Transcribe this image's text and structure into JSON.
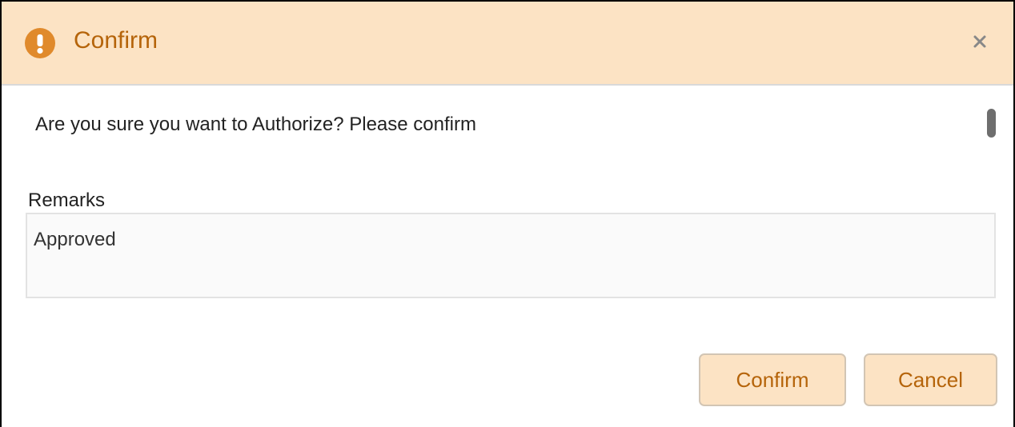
{
  "dialog": {
    "title": "Confirm",
    "message": "Are you sure you want to Authorize? Please confirm",
    "close_icon": "close-icon",
    "warning_icon": "exclamation-icon"
  },
  "remarks": {
    "label": "Remarks",
    "value": "Approved"
  },
  "buttons": {
    "confirm_label": "Confirm",
    "cancel_label": "Cancel"
  },
  "colors": {
    "header_bg": "#fce3c4",
    "accent": "#b5640a",
    "icon_bg": "#e08a2c"
  }
}
